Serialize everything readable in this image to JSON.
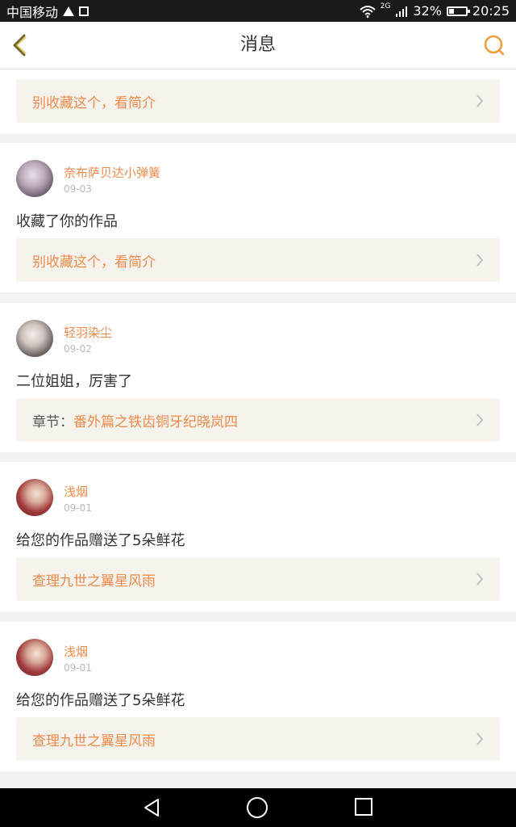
{
  "status_bar": {
    "carrier": "中国移动",
    "network": "2G",
    "battery_percent": "32%",
    "battery_level": 0.32,
    "time": "20:25"
  },
  "header": {
    "title": "消息",
    "back_icon": "chevron-left-icon",
    "search_icon": "search-icon",
    "accent_color": "#f08a4b"
  },
  "cards": [
    {
      "link": {
        "prefix": "",
        "text": "别收藏这个，看简介"
      }
    },
    {
      "user": {
        "name": "奈布萨贝达小弹簧",
        "date": "09-03"
      },
      "message": "收藏了你的作品",
      "link": {
        "prefix": "",
        "text": "别收藏这个，看简介"
      }
    },
    {
      "user": {
        "name": "轻羽染尘",
        "date": "09-02"
      },
      "message": "二位姐姐，厉害了",
      "link": {
        "prefix": "章节：",
        "text": "番外篇之铁齿铜牙纪晓岚四"
      }
    },
    {
      "user": {
        "name": "浅烟",
        "date": "09-01"
      },
      "message": "给您的作品赠送了5朵鲜花",
      "link": {
        "prefix": "",
        "text": "查理九世之翼星风雨"
      }
    },
    {
      "user": {
        "name": "浅烟",
        "date": "09-01"
      },
      "message": "给您的作品赠送了5朵鲜花",
      "link": {
        "prefix": "",
        "text": "查理九世之翼星风雨"
      }
    }
  ]
}
